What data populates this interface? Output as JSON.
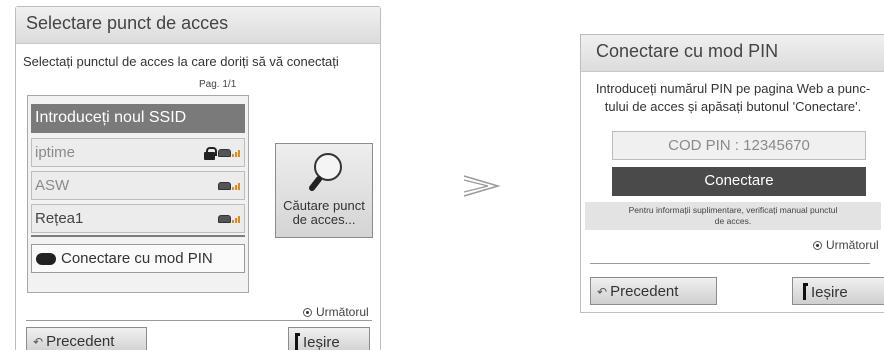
{
  "left_dialog": {
    "title": "Selectare punct de acces",
    "instruction": "Selectați punctul de acces la care doriți să vă conectați",
    "page": "Pag. 1/1",
    "new_ssid": "Introduceți noul SSID",
    "access_points": [
      {
        "name": "iptime",
        "locked": true,
        "icon": "router-signal-icon"
      },
      {
        "name": "ASW",
        "locked": false,
        "icon": "router-signal-icon"
      },
      {
        "name": "Rețea1",
        "locked": false,
        "icon": "router-signal-icon"
      }
    ],
    "pin_mode": "Conectare cu mod PIN",
    "search_button": {
      "line1": "Căutare punct",
      "line2": "de acces..."
    },
    "next": "Următorul",
    "back": "Precedent",
    "exit": "Ieșire"
  },
  "right_dialog": {
    "title": "Conectare cu mod PIN",
    "desc_line1": "Introduceți numărul PIN pe pagina Web a punc-",
    "desc_line2": "tului de acces și apăsați butonul 'Conectare'.",
    "pin_code": "COD PIN : 12345670",
    "connect": "Conectare",
    "info_line1": "Pentru informații suplimentare, verificați manual punctul",
    "info_line2": "de acces.",
    "next": "Următorul",
    "back": "Precedent",
    "exit": "Ieșire"
  },
  "colors": {
    "selected_row": "#7a7a7a",
    "connect_button": "#4a4a4a",
    "signal": "#e08a1e"
  }
}
